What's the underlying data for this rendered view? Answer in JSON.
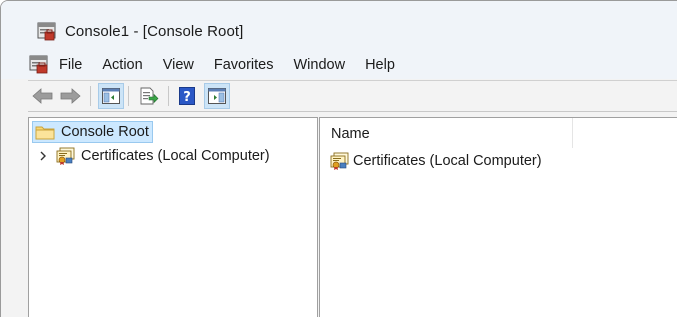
{
  "window": {
    "title": "Console1 - [Console Root]"
  },
  "menu": {
    "items": [
      "File",
      "Action",
      "View",
      "Favorites",
      "Window",
      "Help"
    ]
  },
  "toolbar": {
    "buttons": [
      {
        "icon": "back-arrow-icon",
        "enabled": false
      },
      {
        "icon": "forward-arrow-icon",
        "enabled": false
      },
      {
        "icon": "show-hide-console-tree-icon",
        "active": true
      },
      {
        "icon": "export-list-icon"
      },
      {
        "icon": "help-icon"
      },
      {
        "icon": "show-hide-action-pane-icon",
        "active": true
      }
    ]
  },
  "tree": {
    "root": {
      "label": "Console Root",
      "icon": "folder-icon",
      "selected": true
    },
    "children": [
      {
        "label": "Certificates (Local Computer)",
        "icon": "certificates-icon",
        "expanded": false
      }
    ]
  },
  "list": {
    "columns": [
      "Name"
    ],
    "items": [
      {
        "label": "Certificates (Local Computer)",
        "icon": "certificates-icon"
      }
    ]
  },
  "colors": {
    "selection_bg": "#cce8ff",
    "selection_border": "#99c9ef",
    "titlebar_bg": "#f0f4f9"
  }
}
